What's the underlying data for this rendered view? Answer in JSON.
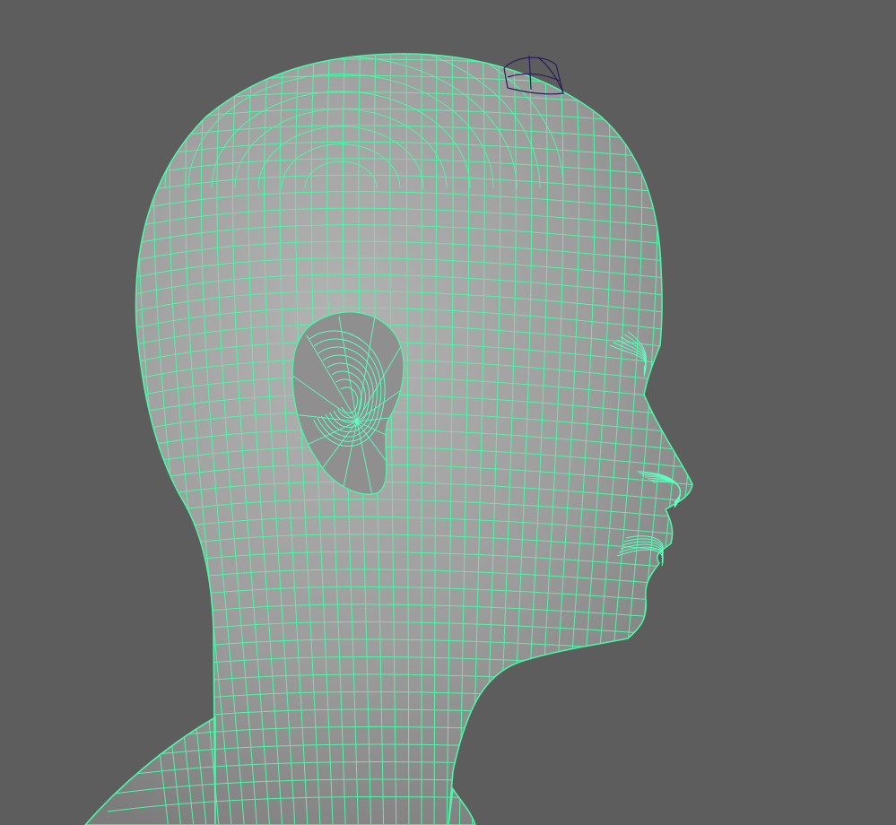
{
  "viewport": {
    "background": "#5d5d5d",
    "mesh": {
      "wire_color": "#4ef5a8",
      "dense_wire_color": "#5cffc0",
      "shade_light": "#b3b3b3",
      "shade_mid": "#9c9c9c",
      "shade_dark": "#7c7c7c",
      "selected": true
    },
    "manipulator": {
      "icon": "camera-locator-icon",
      "color": "#2b1d5c"
    }
  }
}
